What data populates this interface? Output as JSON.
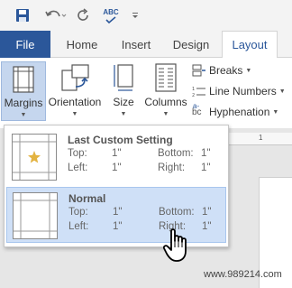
{
  "tabs": {
    "file": "File",
    "home": "Home",
    "insert": "Insert",
    "design": "Design",
    "layout": "Layout"
  },
  "quick_access": {
    "icons": [
      "save-icon",
      "undo-icon",
      "redo-icon",
      "spelling-abc-icon",
      "customize-dropdown-icon"
    ],
    "spelling_label": "ABC"
  },
  "ribbon": {
    "margins_label": "Margins",
    "orientation_label": "Orientation",
    "size_label": "Size",
    "columns_label": "Columns",
    "breaks_label": "Breaks",
    "line_numbers_label": "Line Numbers",
    "hyphenation_label": "Hyphenation",
    "hyphenation_icon_text": "bc"
  },
  "ruler": {
    "mark": "1"
  },
  "margins_menu": {
    "items": [
      {
        "title": "Last Custom Setting",
        "top_label": "Top:",
        "top_value": "1\"",
        "bottom_label": "Bottom:",
        "bottom_value": "1\"",
        "left_label": "Left:",
        "left_value": "1\"",
        "right_label": "Right:",
        "right_value": "1\""
      },
      {
        "title": "Normal",
        "top_label": "Top:",
        "top_value": "1\"",
        "bottom_label": "Bottom:",
        "bottom_value": "1\"",
        "left_label": "Left:",
        "left_value": "1\"",
        "right_label": "Right:",
        "right_value": "1\""
      }
    ]
  },
  "watermark": "www.989214.com",
  "colors": {
    "file_tab": "#2b579a",
    "selected_button": "#c5d6ee",
    "hover_item": "#cfe0f7",
    "star": "#e3b341"
  }
}
